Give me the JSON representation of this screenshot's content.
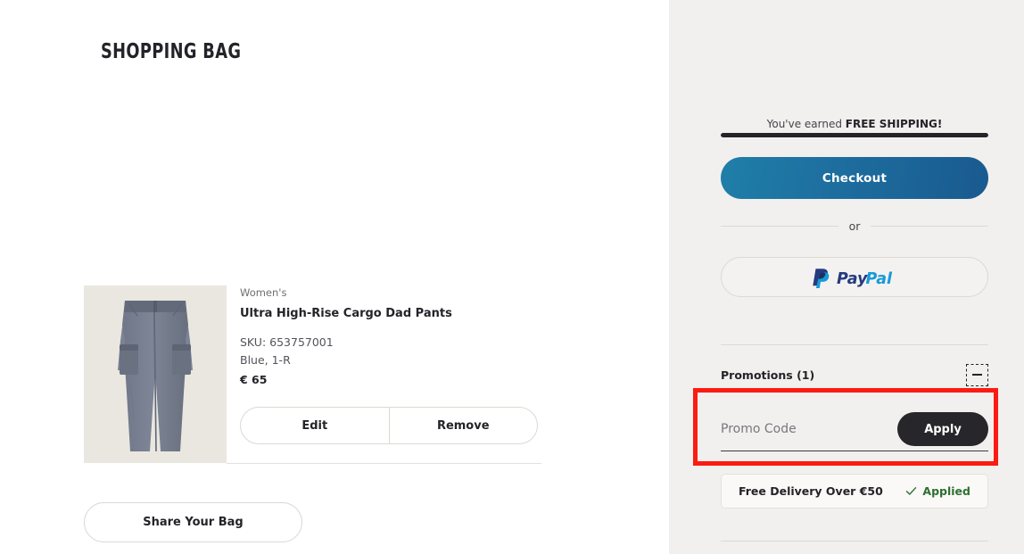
{
  "main": {
    "page_title": "SHOPPING BAG",
    "item": {
      "category": "Women's",
      "name": "Ultra High-Rise Cargo Dad Pants",
      "sku": "SKU: 653757001",
      "variant": "Blue, 1-R",
      "price": "€ 65",
      "edit_label": "Edit",
      "remove_label": "Remove",
      "image_alt": "blue-grey cargo pants"
    },
    "share_label": "Share Your Bag"
  },
  "sidebar": {
    "shipping": {
      "prefix": "You've earned ",
      "highlight": "FREE SHIPPING!",
      "progress_percent": 100
    },
    "checkout_label": "Checkout",
    "or_label": "or",
    "paypal": {
      "pay_text": "Pay",
      "pal_text": "Pal",
      "dark_color": "#253b80",
      "light_color": "#179bd7"
    },
    "promotions": {
      "title": "Promotions (1)",
      "collapse_icon": "minus-icon",
      "promo_placeholder": "Promo Code",
      "promo_value": "",
      "apply_label": "Apply",
      "applied": {
        "name": "Free Delivery Over €50",
        "status": "Applied",
        "check_icon": "check-icon",
        "status_color": "#2e7031"
      }
    }
  },
  "annotation": {
    "highlight_color": "#fb1b12"
  }
}
